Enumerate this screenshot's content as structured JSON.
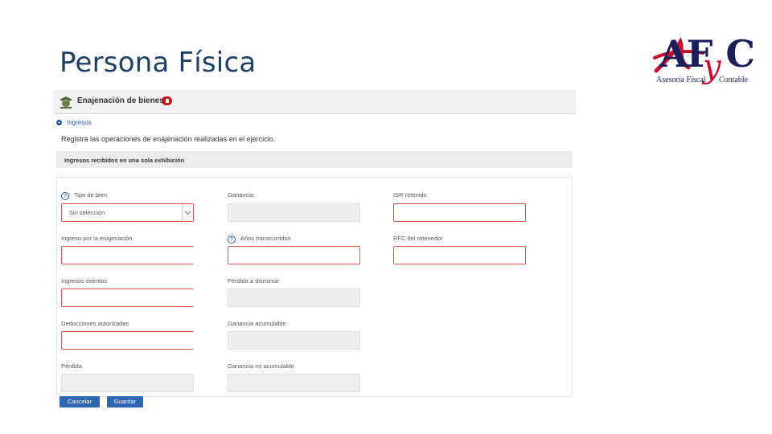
{
  "slide": {
    "title": "Persona Física"
  },
  "logo": {
    "letters": "AF",
    "y": "y",
    "c": "C",
    "sub1": "Asesoría Fiscal",
    "sub2": "Contable",
    "colors": {
      "navy": "#1a1f5c",
      "red": "#c8102e"
    }
  },
  "app": {
    "header": {
      "title": "Enajenación de bienes",
      "icon": "eagle-emblem-icon"
    },
    "nav": {
      "link": "Ingresos",
      "icon": "circle-arrow-icon"
    },
    "instruction": "Registra las operaciones de enajenación realizadas en el ejercicio.",
    "section": "Ingresos recibidos en una sola exhibición",
    "fields": {
      "tipo_bien": {
        "label": "Tipo de bien",
        "value": "Sin selección"
      },
      "ganancia": {
        "label": "Ganancia"
      },
      "isr_retenido": {
        "label": "ISR retenido"
      },
      "ingreso_enajenacion": {
        "label": "Ingreso por la enajenación"
      },
      "anos_transcurridos": {
        "label": "Años transcurridos"
      },
      "rfc_retenedor": {
        "label": "RFC del retenedor"
      },
      "ingresos_exentos": {
        "label": "Ingresos exentos"
      },
      "perdida_disminuir": {
        "label": "Pérdida a disminuir"
      },
      "deducciones": {
        "label": "Deducciones autorizadas"
      },
      "ganancia_acumulable": {
        "label": "Ganancia acumulable"
      },
      "perdida": {
        "label": "Pérdida"
      },
      "ganancia_no_acumulable": {
        "label": "Ganancia no acumulable"
      }
    },
    "buttons": {
      "cancel": "Cancelar",
      "save": "Guardar"
    },
    "colors": {
      "accent": "#2c67b1",
      "required": "#d9534f",
      "badge": "#c4161c"
    }
  }
}
